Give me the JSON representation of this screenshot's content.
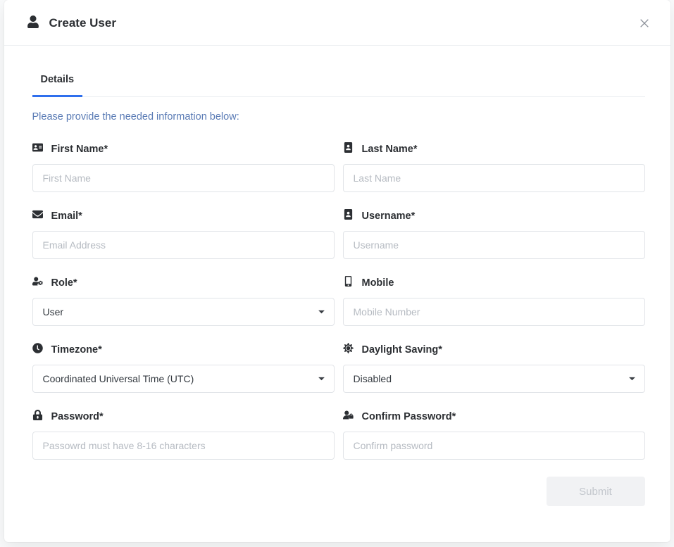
{
  "header": {
    "title": "Create User"
  },
  "tabs": {
    "details": "Details"
  },
  "instruction": "Please provide the needed information below:",
  "fields": {
    "first_name": {
      "label": "First Name*",
      "placeholder": "First Name"
    },
    "last_name": {
      "label": "Last Name*",
      "placeholder": "Last Name"
    },
    "email": {
      "label": "Email*",
      "placeholder": "Email Address"
    },
    "username": {
      "label": "Username*",
      "placeholder": "Username"
    },
    "role": {
      "label": "Role*",
      "selected": "User"
    },
    "mobile": {
      "label": "Mobile",
      "placeholder": "Mobile Number"
    },
    "timezone": {
      "label": "Timezone*",
      "selected": "Coordinated Universal Time (UTC)"
    },
    "dst": {
      "label": "Daylight Saving*",
      "selected": "Disabled"
    },
    "password": {
      "label": "Password*",
      "placeholder": "Passowrd must have 8-16 characters"
    },
    "confirm": {
      "label": "Confirm Password*",
      "placeholder": "Confirm password"
    }
  },
  "footer": {
    "submit": "Submit"
  }
}
